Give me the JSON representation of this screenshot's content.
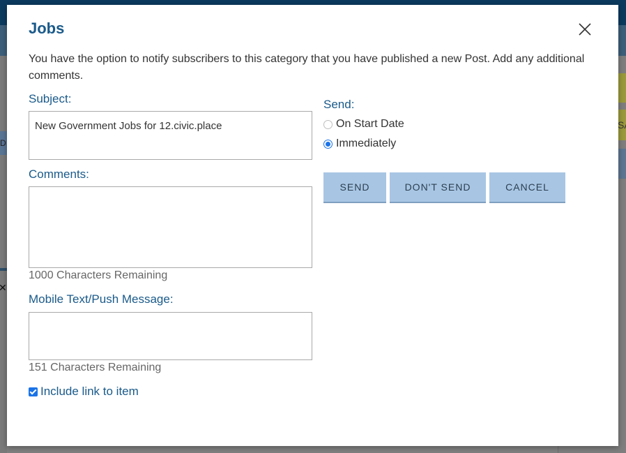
{
  "dialog": {
    "title": "Jobs",
    "intro": "You have the option to notify subscribers to this category that you have published a new Post. Add any additional comments."
  },
  "subject": {
    "label": "Subject:",
    "value": "New Government Jobs for 12.civic.place"
  },
  "comments": {
    "label": "Comments:",
    "value": "",
    "remaining": "1000 Characters Remaining"
  },
  "mobile": {
    "label": "Mobile Text/Push Message:",
    "value": "",
    "remaining": "151 Characters Remaining"
  },
  "include_link": {
    "label": "Include link to item",
    "checked": true
  },
  "send": {
    "label": "Send:",
    "options": [
      {
        "label": "On Start Date",
        "selected": false
      },
      {
        "label": "Immediately",
        "selected": true
      }
    ]
  },
  "buttons": {
    "send": "SEND",
    "dont_send": "DON'T SEND",
    "cancel": "CANCEL"
  },
  "background": {
    "partial_text_right": "SA",
    "partial_text_left": "D"
  },
  "icons": {
    "close": "close-icon"
  },
  "colors": {
    "accent": "#1a5a8a",
    "button": "#a8c6e4",
    "radio_checked": "#1a73e8"
  }
}
